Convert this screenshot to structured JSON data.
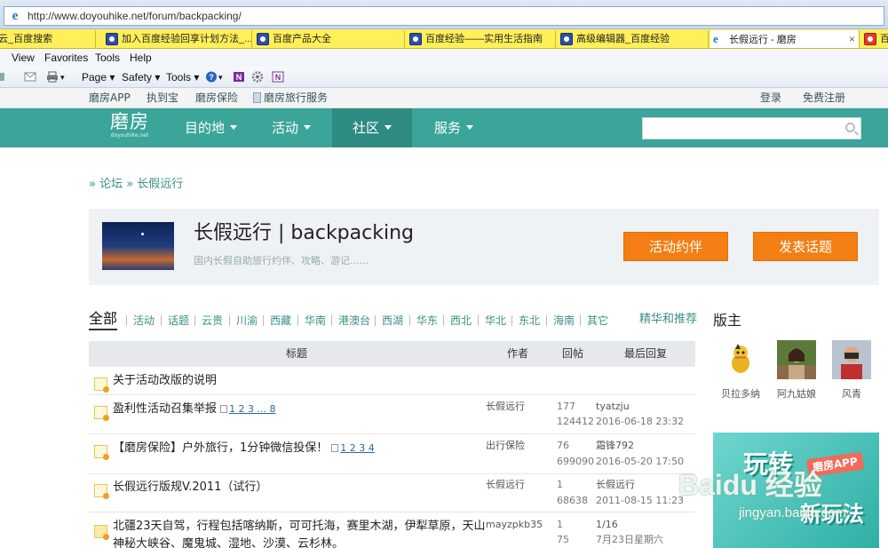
{
  "browser": {
    "address": "http://www.doyouhike.net/forum/backpacking/",
    "tabs": [
      {
        "label": "云_百度搜索"
      },
      {
        "label": "加入百度经验回享计划方法_..."
      },
      {
        "label": "百度产品大全"
      },
      {
        "label": "百度经验——实用生活指南"
      },
      {
        "label": "高级编辑器_百度经验"
      },
      {
        "label": "长假远行 - 磨房",
        "active": true
      },
      {
        "label": "百度"
      }
    ],
    "tab_close": "×",
    "menu": [
      "View",
      "Favorites",
      "Tools",
      "Help"
    ],
    "commands": {
      "page": "Page",
      "safety": "Safety",
      "tools": "Tools"
    }
  },
  "site": {
    "strip": {
      "app": "磨房APP",
      "zhidaobao": "执到宝",
      "insurance": "磨房保险",
      "travel_service": "磨房旅行服务",
      "login": "登录",
      "register": "免费注册"
    },
    "logo": {
      "main": "磨房",
      "sub": "doyouhike.net"
    },
    "nav": [
      "目的地",
      "活动",
      "社区",
      "服务"
    ],
    "search_placeholder": ""
  },
  "breadcrumb": "» 论坛 » 长假远行",
  "forum": {
    "title": "长假远行 | backpacking",
    "subtitle": "国内长假自助旅行约伴、攻略、游记......",
    "btn_activity": "活动约伴",
    "btn_post": "发表话题"
  },
  "categories": {
    "all": "全部",
    "items": [
      "活动",
      "话题",
      "云贵",
      "川渝",
      "西藏",
      "华南",
      "港澳台",
      "西湖",
      "华东",
      "西北",
      "华北",
      "东北",
      "海南",
      "其它"
    ],
    "featured": "精华和推荐"
  },
  "table": {
    "headers": {
      "title": "标题",
      "author": "作者",
      "replies": "回帖",
      "last": "最后回复"
    },
    "rows": [
      {
        "title": "关于活动改版的说明",
        "pages": "",
        "author": "",
        "replies": "",
        "views": "",
        "last_user": "",
        "last_time": ""
      },
      {
        "title": "盈利性活动召集举报",
        "pages": "1 2 3 ... 8",
        "author": "长假远行",
        "replies": "177",
        "views": "124412",
        "last_user": "tyatzju",
        "last_time": "2016-06-18 23:32"
      },
      {
        "title": "【磨房保险】户外旅行，1分钟微信投保！",
        "pages": "1 2 3 4",
        "author": "出行保险",
        "replies": "76",
        "views": "699090",
        "last_user": "霜锋792",
        "last_time": "2016-05-20 17:50"
      },
      {
        "title": "长假远行版规V.2011（试行）",
        "pages": "",
        "author": "长假远行",
        "replies": "1",
        "views": "68638",
        "last_user": "长假远行",
        "last_time": "2011-08-15 11:23"
      },
      {
        "title": "北疆23天自驾，行程包括喀纳斯，可可托海，赛里木湖，伊犁草原，天山",
        "title2": "神秘大峡谷、魔鬼城、湿地、沙漠、云杉林。",
        "pages": "",
        "author": "mayzpkb35",
        "replies": "1",
        "views": "75",
        "last_user": "1/16",
        "last_time": "7月23日星期六"
      }
    ]
  },
  "sidebar": {
    "moderators_title": "版主",
    "moderators": [
      {
        "name": "贝拉多纳"
      },
      {
        "name": "阿九姑娘"
      },
      {
        "name": "风青"
      }
    ],
    "ad": {
      "tag": "磨房APP",
      "line1": "玩转",
      "line2": "新玩法"
    }
  },
  "watermark": {
    "line1": "Baidu 经验",
    "line2": "jingyan.baidu.com"
  }
}
